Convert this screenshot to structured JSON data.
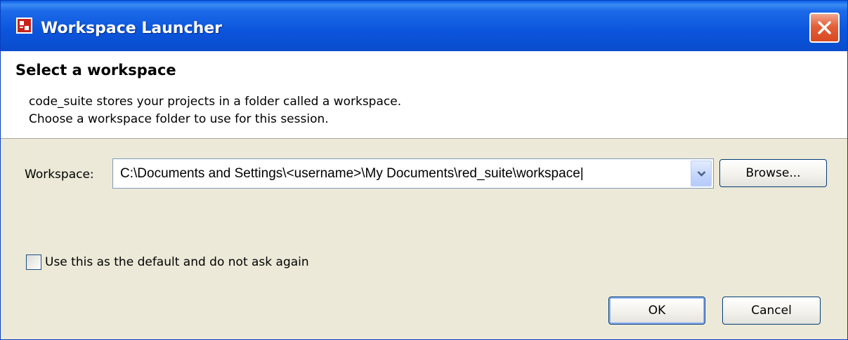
{
  "window": {
    "title": "Workspace Launcher",
    "icons": {
      "app": "eclipse-app-icon",
      "close": "close-x-icon"
    }
  },
  "header": {
    "title": "Select a workspace",
    "description_line1": "code_suite stores your projects in a folder called a workspace.",
    "description_line2": "Choose a workspace folder to use for this session."
  },
  "workspace": {
    "label": "Workspace:",
    "value": "C:\\Documents and Settings\\<username>\\My Documents\\red_suite\\workspace|",
    "dropdown_icon": "chevron-down-icon",
    "browse_label": "Browse..."
  },
  "options": {
    "default_checkbox_label": "Use this as the default and do not ask again",
    "default_checked": false
  },
  "buttons": {
    "ok_label": "OK",
    "cancel_label": "Cancel"
  },
  "colors": {
    "titlebar": "#0b55dc",
    "dialog_bg": "#ece9d8",
    "header_bg": "#ffffff",
    "close_button": "#d84a22"
  }
}
